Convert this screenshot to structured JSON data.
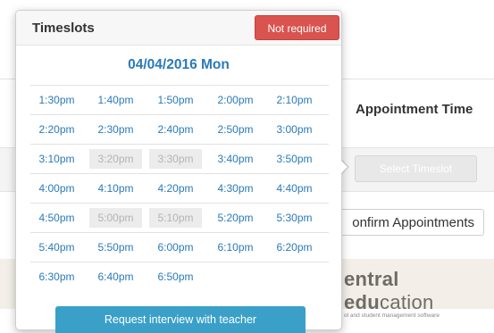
{
  "background": {
    "appointment_time_heading": "Appointment Time",
    "select_timeslot_label": "Select Timeslot",
    "confirm_appointments_label": "onfirm Appointments",
    "logo": {
      "main_bold": "entral edu",
      "main_light": "cation",
      "tagline": "ol and student management software"
    }
  },
  "popover": {
    "title": "Timeslots",
    "not_required_label": "Not required",
    "date": "04/04/2016 Mon",
    "rows": [
      [
        {
          "time": "1:30pm",
          "disabled": false
        },
        {
          "time": "1:40pm",
          "disabled": false
        },
        {
          "time": "1:50pm",
          "disabled": false
        },
        {
          "time": "2:00pm",
          "disabled": false
        },
        {
          "time": "2:10pm",
          "disabled": false
        }
      ],
      [
        {
          "time": "2:20pm",
          "disabled": false
        },
        {
          "time": "2:30pm",
          "disabled": false
        },
        {
          "time": "2:40pm",
          "disabled": false
        },
        {
          "time": "2:50pm",
          "disabled": false
        },
        {
          "time": "3:00pm",
          "disabled": false
        }
      ],
      [
        {
          "time": "3:10pm",
          "disabled": false
        },
        {
          "time": "3:20pm",
          "disabled": true
        },
        {
          "time": "3:30pm",
          "disabled": true
        },
        {
          "time": "3:40pm",
          "disabled": false
        },
        {
          "time": "3:50pm",
          "disabled": false
        }
      ],
      [
        {
          "time": "4:00pm",
          "disabled": false
        },
        {
          "time": "4:10pm",
          "disabled": false
        },
        {
          "time": "4:20pm",
          "disabled": false
        },
        {
          "time": "4:30pm",
          "disabled": false
        },
        {
          "time": "4:40pm",
          "disabled": false
        }
      ],
      [
        {
          "time": "4:50pm",
          "disabled": false
        },
        {
          "time": "5:00pm",
          "disabled": true
        },
        {
          "time": "5:10pm",
          "disabled": true
        },
        {
          "time": "5:20pm",
          "disabled": false
        },
        {
          "time": "5:30pm",
          "disabled": false
        }
      ],
      [
        {
          "time": "5:40pm",
          "disabled": false
        },
        {
          "time": "5:50pm",
          "disabled": false
        },
        {
          "time": "6:00pm",
          "disabled": false
        },
        {
          "time": "6:10pm",
          "disabled": false
        },
        {
          "time": "6:20pm",
          "disabled": false
        }
      ],
      [
        {
          "time": "6:30pm",
          "disabled": false
        },
        {
          "time": "6:40pm",
          "disabled": false
        },
        {
          "time": "6:50pm",
          "disabled": false
        }
      ]
    ],
    "request_button_label": "Request interview with teacher"
  },
  "colors": {
    "accent_blue": "#2a7ab8",
    "danger_red": "#d9534f",
    "request_button": "#3aa0c8"
  }
}
